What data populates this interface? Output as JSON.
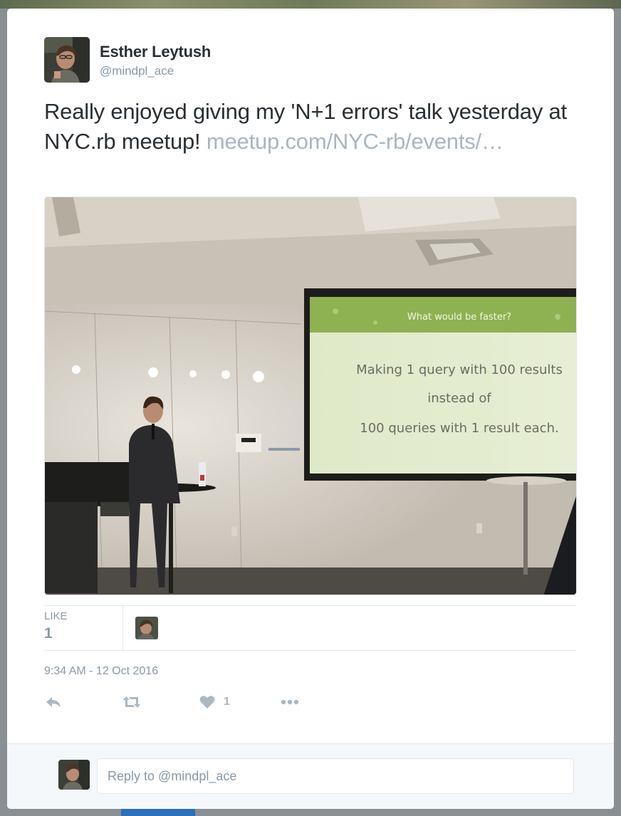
{
  "author": {
    "name": "Esther Leytush",
    "handle": "@mindpl_ace"
  },
  "tweet": {
    "text": "Really enjoyed giving my 'N+1 errors' talk yesterday at NYC.rb meetup!",
    "link_text": "meetup.com/NYC-rb/events/…"
  },
  "photo": {
    "slide_title": "What would be faster?",
    "slide_line1": "Making 1 query with 100 results",
    "slide_line2": "instead of",
    "slide_line3": "100 queries with 1 result each."
  },
  "stats": {
    "like_label": "LIKE",
    "like_count": "1"
  },
  "timestamp": "9:34 AM - 12 Oct 2016",
  "actions": {
    "reply_icon": "reply-icon",
    "retweet_icon": "retweet-icon",
    "like_icon": "heart-icon",
    "like_count": "1",
    "more_icon": "more-icon"
  },
  "reply": {
    "placeholder": "Reply to @mindpl_ace"
  },
  "colors": {
    "text_primary": "#292f33",
    "text_secondary": "#8899a6",
    "link": "#a9b6c2",
    "border": "#e1e8ed",
    "reply_bg": "#f5f8fa"
  }
}
